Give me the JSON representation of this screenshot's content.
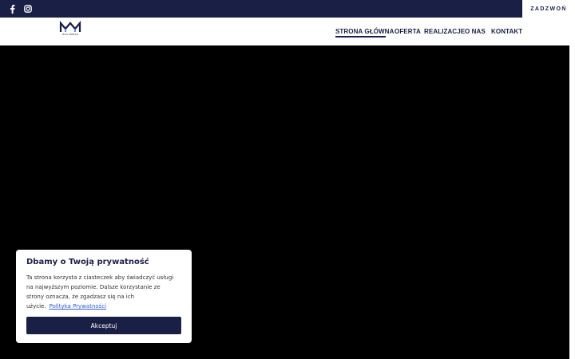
{
  "topbar": {
    "social": [
      {
        "icon": "facebook-icon"
      },
      {
        "icon": "instagram-icon"
      }
    ],
    "call_label": "ZADZWOŃ"
  },
  "logo": {
    "mark": "MN",
    "subtitle": "MAX MEBLE"
  },
  "nav": {
    "items": [
      {
        "label": "STRONA GŁÓWNA",
        "active": true
      },
      {
        "label": "OFERTA",
        "active": false
      },
      {
        "label": "REALIZACJE",
        "active": false
      },
      {
        "label": "O NAS",
        "active": false
      },
      {
        "label": "KONTAKT",
        "active": false
      }
    ]
  },
  "cookie": {
    "title": "Dbamy o Twoją prywatność",
    "text": "Ta strona korzysta z ciasteczek aby świadczyć usługi na najwyższym poziomie. Dalsze korzystanie ze strony oznacza, że zgadzasz się na ich użycie.",
    "link": "Polityka Prywatności",
    "accept": "Akceptuj"
  },
  "colors": {
    "brand_navy": "#1a1f45",
    "link": "#2f5bd9"
  }
}
